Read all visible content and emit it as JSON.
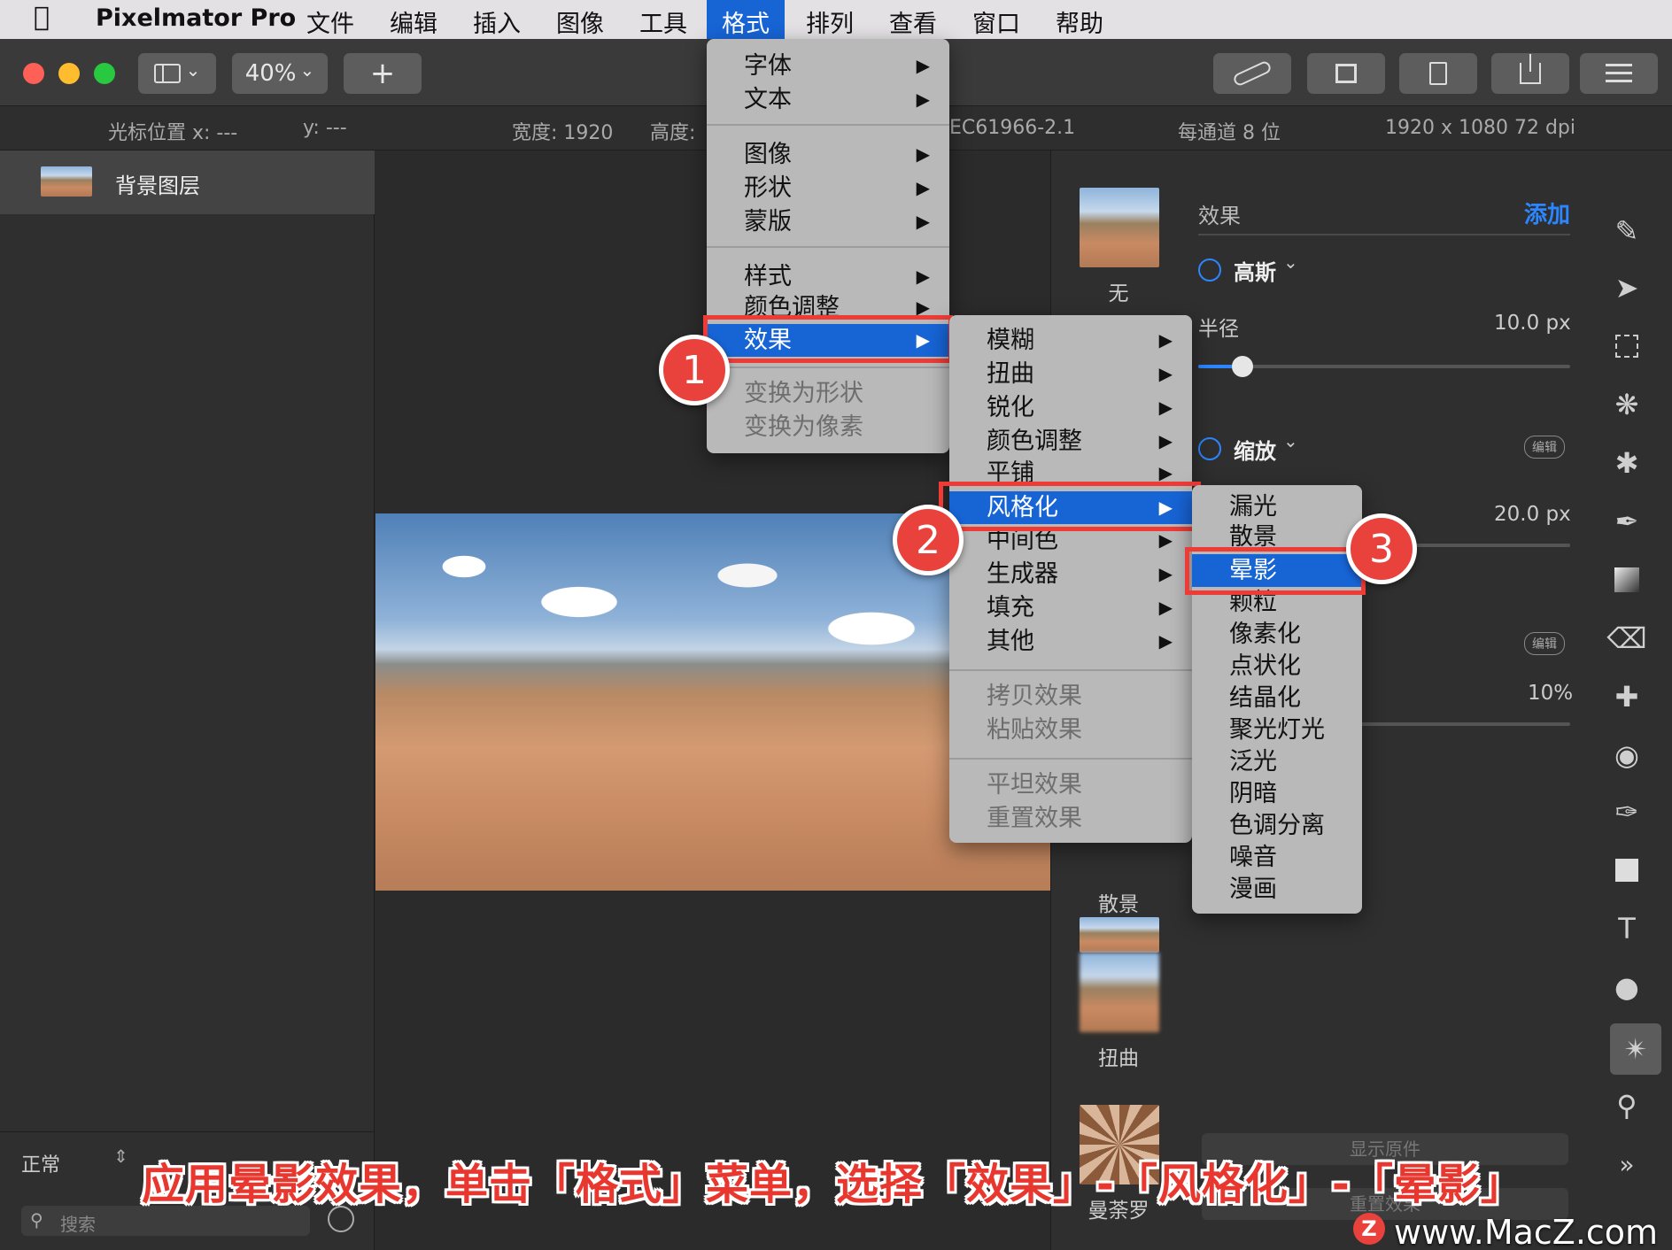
{
  "menubar": {
    "app_name": "Pixelmator Pro",
    "items": [
      "文件",
      "编辑",
      "插入",
      "图像",
      "工具",
      "格式",
      "排列",
      "查看",
      "窗口",
      "帮助"
    ]
  },
  "toolbar": {
    "zoom": "40%",
    "add_label": "+"
  },
  "infobar": {
    "cursor_x": "光标位置 x: ---",
    "cursor_y": "y: ---",
    "width": "宽度: 1920",
    "height": "高度:",
    "color_profile": "EC61966-2.1",
    "bit_depth": "每通道 8 位",
    "resolution": "1920 x 1080 72 dpi"
  },
  "layers": {
    "items": [
      {
        "name": "背景图层"
      }
    ],
    "blend_mode": "正常",
    "search_placeholder": "搜索"
  },
  "effects_panel": {
    "title": "效果",
    "add_label": "添加",
    "presets": [
      "无",
      "散景",
      "扭曲",
      "曼荼罗"
    ],
    "effect1": {
      "name": "高斯",
      "param_label": "半径",
      "param_value": "10.0 px",
      "slider": 0.12
    },
    "effect2": {
      "name": "缩放",
      "param_value": "20.0 px",
      "badge": "编辑"
    },
    "effect3": {
      "badge": "编辑",
      "param_value": "10%"
    },
    "bottom_buttons": [
      "显示原件",
      "重置效果"
    ]
  },
  "format_menu": {
    "items": [
      {
        "label": "字体",
        "arrow": true
      },
      {
        "label": "文本",
        "arrow": true
      },
      {
        "label": "图像",
        "arrow": true
      },
      {
        "label": "形状",
        "arrow": true
      },
      {
        "label": "蒙版",
        "arrow": true
      },
      {
        "label": "样式",
        "arrow": true
      },
      {
        "label": "颜色调整",
        "arrow": true
      },
      {
        "label": "效果",
        "arrow": true
      },
      {
        "label": "变换为形状",
        "arrow": false
      },
      {
        "label": "变换为像素",
        "arrow": false
      }
    ]
  },
  "effects_submenu": {
    "items": [
      {
        "label": "模糊"
      },
      {
        "label": "扭曲"
      },
      {
        "label": "锐化"
      },
      {
        "label": "颜色调整"
      },
      {
        "label": "平铺"
      },
      {
        "label": "风格化"
      },
      {
        "label": "中间色"
      },
      {
        "label": "生成器"
      },
      {
        "label": "填充"
      },
      {
        "label": "其他"
      },
      {
        "label": "拷贝效果"
      },
      {
        "label": "粘贴效果"
      },
      {
        "label": "平坦效果"
      },
      {
        "label": "重置效果"
      }
    ]
  },
  "stylize_submenu": {
    "items": [
      "漏光",
      "散景",
      "晕影",
      "颗粒",
      "像素化",
      "点状化",
      "结晶化",
      "聚光灯光",
      "泛光",
      "阴暗",
      "色调分离",
      "噪音",
      "漫画"
    ]
  },
  "steps": [
    "1",
    "2",
    "3"
  ],
  "caption": "应用晕影效果，单击「格式」菜单，选择「效果」-「风格化」-「晕影」",
  "watermark": "www.MacZ.com",
  "watermark_logo": "Z",
  "arrow_glyph": "▶",
  "chevron_glyph": "⌄"
}
